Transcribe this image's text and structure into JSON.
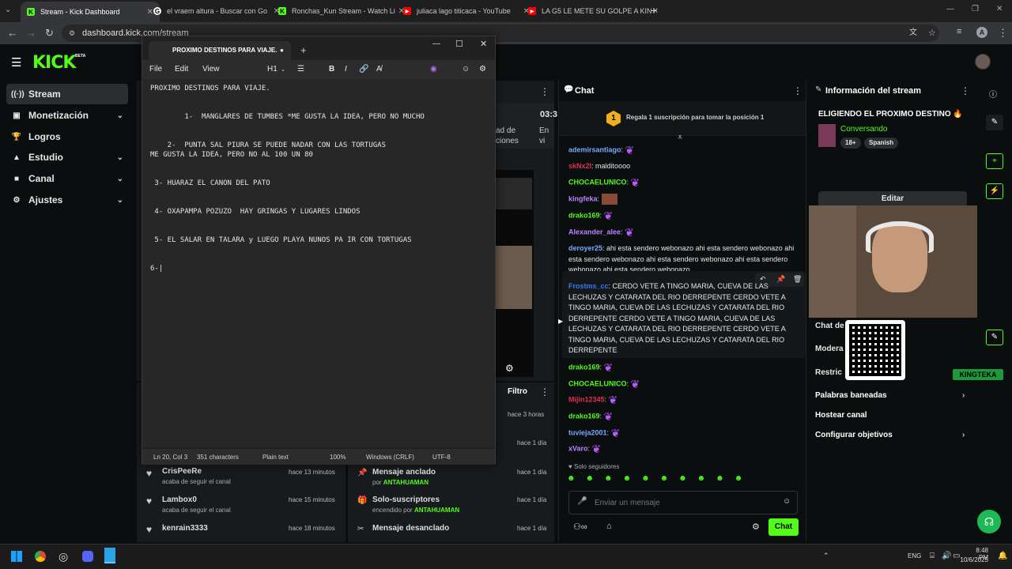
{
  "browser": {
    "tabs": [
      {
        "title": "Stream - Kick Dashboard",
        "color": "#53fc18",
        "letter": "K"
      },
      {
        "title": "el vraem altura - Buscar con Go",
        "color": "#ffffff",
        "letter": "G"
      },
      {
        "title": "Ronchas_Kun Stream - Watch Li",
        "color": "#53fc18",
        "letter": "K"
      },
      {
        "title": "juliaca lago titicaca - YouTube",
        "color": "#ff0000",
        "letter": "▶"
      },
      {
        "title": "LA G5 LE METE SU GOLPE A KIN",
        "color": "#ff0000",
        "letter": "▶"
      }
    ],
    "new_tab": "+",
    "url": "dashboard.kick.com/stream",
    "profile_initial": "A"
  },
  "kick": {
    "logo": "KICK",
    "logo_badge": "BETA",
    "sidebar": [
      {
        "label": "Stream",
        "icon": "((·))",
        "active": true
      },
      {
        "label": "Monetización",
        "icon": "▣",
        "chevron": true
      },
      {
        "label": "Logros",
        "icon": "🏆"
      },
      {
        "label": "Estudio",
        "icon": "▲",
        "chevron": true
      },
      {
        "label": "Canal",
        "icon": "■",
        "chevron": true
      },
      {
        "label": "Ajustes",
        "icon": "⚙",
        "chevron": true
      }
    ]
  },
  "notepad": {
    "tab_title": "PROXIMO DESTINOS PARA VIAJE.",
    "menu": [
      "File",
      "Edit",
      "View"
    ],
    "heading_btn": "H1",
    "content": "PROXIMO DESTINOS PARA VIAJE.\n\n\n        1-  MANGLARES DE TUMBES *ME GUSTA LA IDEA, PERO NO MUCHO\n\n\n    2-  PUNTA SAL PIURA SE PUEDE NADAR CON LAS TORTUGAS\nME GUSTA LA IDEA, PERO NO AL 100 UN 80\n\n\n 3- HUARAZ EL CANON DEL PATO\n\n\n 4- OXAPAMPA POZUZO  HAY GRINGAS Y LUGARES LINDOS\n\n\n 5- EL SALAR EN TALARA y LUEGO PLAYA NUNOS PA IR CON TORTUGAS\n\n\n6-|",
    "status": {
      "position": "Ln 20, Col 3",
      "chars": "351 characters",
      "format": "Plain text",
      "zoom": "100%",
      "eol": "Windows (CRLF)",
      "encoding": "UTF-8"
    }
  },
  "video_panel": {
    "time": "03:3",
    "stat1_lines": [
      "ad de",
      "ciones"
    ],
    "stat2_lines": [
      "En",
      "vi"
    ]
  },
  "activity": {
    "filter": "Filtro",
    "followers": [
      {
        "name": "CrisPeeRe",
        "sub": "acaba de seguir el canal",
        "time": "hace 13 minutos"
      },
      {
        "name": "Lambox0",
        "sub": "acaba de seguir el canal",
        "time": "hace 15 minutos"
      },
      {
        "name": "kenrain3333",
        "sub": "",
        "time": "hace 18 minutos"
      }
    ],
    "events": [
      {
        "title": "",
        "sub": "",
        "time": "hace 3 horas"
      },
      {
        "title": "",
        "sub": "",
        "time": "hace 1 día"
      },
      {
        "title": "Mensaje anclado",
        "by": "por",
        "who": "ANTAHUAMAN",
        "time": "hace 1 día",
        "icon": "📌"
      },
      {
        "title": "Solo-suscriptores",
        "by": "encendido por",
        "who": "ANTAHUAMAN",
        "time": "hace 1 día",
        "icon": "🎁"
      },
      {
        "title": "Mensaje desanclado",
        "by": "",
        "who": "",
        "time": "hace 1 día",
        "icon": "✂"
      }
    ]
  },
  "chat": {
    "title": "Chat",
    "gift_rank": "1",
    "gift_text": "Regala 1 suscripción para tomar la posición 1",
    "messages": [
      {
        "user": "ademirsantiago",
        "color": "#7aa7ff",
        "text": "",
        "emote": true
      },
      {
        "user": "skNx2l",
        "color": "#e0314d",
        "text": "malditoooo"
      },
      {
        "user": "CHOCAELUNICO",
        "color": "#53fc18",
        "text": "",
        "emote": true
      },
      {
        "user": "kingfeka",
        "color": "#b785ff",
        "text": "",
        "img": true
      },
      {
        "user": "drako169",
        "color": "#53fc18",
        "text": "",
        "emote": true
      },
      {
        "user": "Alexander_alee",
        "color": "#b785ff",
        "text": "",
        "emote": true
      },
      {
        "user": "deroyer25",
        "color": "#7aa7ff",
        "text": "ahi esta sendero webonazo ahi esta sendero webonazo ahi esta sendero webonazo ahi esta sendero webonazo ahi esta sendero webonazo ahi esta sendero webonazo"
      },
      {
        "user": "Frostms_cc",
        "color": "#2f7bf5",
        "text": "CERDO VETE A TINGO MARIA, CUEVA DE LAS LECHUZAS Y CATARATA DEL RIO DERREPENTE  CERDO VETE A TINGO MARIA, CUEVA DE LAS LECHUZAS Y CATARATA DEL RIO DERREPENTE  CERDO VETE A TINGO MARIA, CUEVA DE LAS LECHUZAS Y CATARATA DEL RIO DERREPENTE  CERDO VETE A TINGO MARIA, CUEVA DE LAS LECHUZAS Y CATARATA DEL RIO DERREPENTE"
      },
      {
        "user": "drako169",
        "color": "#53fc18",
        "text": "",
        "emote": true
      },
      {
        "user": "CHOCAELUNICO",
        "color": "#53fc18",
        "text": "",
        "emote": true
      },
      {
        "user": "Mijin12345",
        "color": "#e0314d",
        "text": "",
        "emote": true
      },
      {
        "user": "drako169",
        "color": "#53fc18",
        "text": "",
        "emote": true
      },
      {
        "user": "tuvieja2001",
        "color": "#7aa7ff",
        "text": "",
        "emote": true
      },
      {
        "user": "xVaro",
        "color": "#b785ff",
        "text": "",
        "emote": true
      }
    ],
    "followers_only": "Solo seguidores",
    "input_placeholder": "Enviar un mensaje",
    "send_label": "Chat"
  },
  "info": {
    "title": "Información del stream",
    "stream_title": "ELIGIENDO EL PROXIMO DESTINO",
    "category": "Conversando",
    "tags": [
      "18+",
      "Spanish"
    ],
    "edit_label": "Editar",
    "hidden_rows": [
      "Chat de",
      "Modera",
      "Restric"
    ],
    "links": [
      "Palabras baneadas",
      "Hostear canal",
      "Configurar objetivos"
    ],
    "webcam_label": "KINGTEKA"
  },
  "taskbar": {
    "lang": "ENG",
    "time": "8:48 PM",
    "date": "10/6/2025"
  },
  "colors": {
    "kick_green": "#53fc18",
    "panel": "#181b1d",
    "bg": "#0b0e0f"
  }
}
